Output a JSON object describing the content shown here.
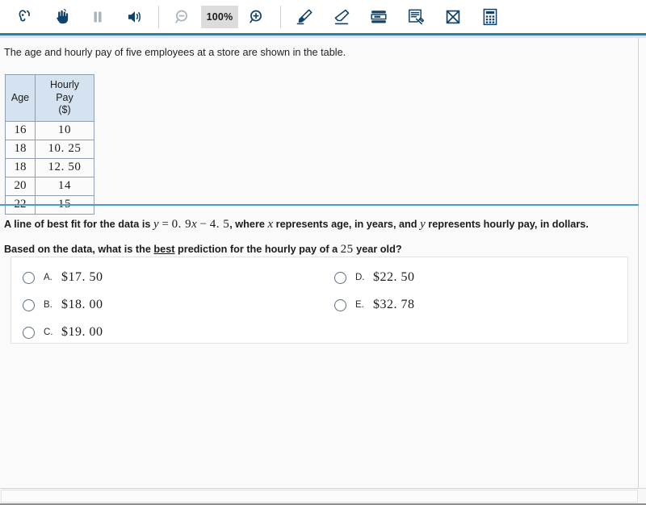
{
  "toolbar": {
    "tools": [
      {
        "name": "listen-icon",
        "label": "Listen",
        "state": "enabled"
      },
      {
        "name": "pointer-hand-icon",
        "label": "Pointer",
        "state": "enabled"
      },
      {
        "name": "pause-icon",
        "label": "Pause",
        "state": "disabled"
      },
      {
        "name": "volume-icon",
        "label": "Volume",
        "state": "enabled"
      },
      {
        "name": "zoom-out-icon",
        "label": "Zoom Out",
        "state": "enabled"
      },
      {
        "name": "zoom-level",
        "label": "100%",
        "state": "enabled"
      },
      {
        "name": "zoom-in-icon",
        "label": "Zoom In",
        "state": "enabled"
      },
      {
        "name": "highlighter-icon",
        "label": "Highlighter",
        "state": "enabled"
      },
      {
        "name": "eraser-icon",
        "label": "Eraser",
        "state": "enabled"
      },
      {
        "name": "line-reader-icon",
        "label": "Line Reader",
        "state": "enabled"
      },
      {
        "name": "notepad-icon",
        "label": "Notepad",
        "state": "enabled"
      },
      {
        "name": "cross-out-icon",
        "label": "Answer Eliminator",
        "state": "enabled"
      },
      {
        "name": "calculator-icon",
        "label": "Calculator",
        "state": "enabled"
      }
    ],
    "zoom_level": "100%",
    "accent_color": "#10436b",
    "disabled_color": "#a8b4bd",
    "rule_dark_color": "#2e7fa3",
    "rule_light_color": "#d7e6ee"
  },
  "question": {
    "intro": "The age and hourly pay of five employees at a store are shown in the table.",
    "best_fit_prefix": "A line of best fit for the data is ",
    "best_fit_eq_y": "y",
    "best_fit_eq_equals": " = ",
    "best_fit_eq_slope": "0. 9",
    "best_fit_eq_x": "x",
    "best_fit_eq_minus": " − ",
    "best_fit_eq_intercept": "4. 5",
    "best_fit_mid": ", where ",
    "best_fit_var_x": "x",
    "best_fit_x_desc": " represents age, in years, and ",
    "best_fit_var_y": "y",
    "best_fit_y_desc": " represents hourly pay, in dollars.",
    "prompt_prefix": "Based on the data, what is the ",
    "prompt_emph": "best",
    "prompt_mid": " prediction for the hourly pay of a ",
    "prompt_number": "25",
    "prompt_suffix": " year old?"
  },
  "table": {
    "headers": [
      "Age",
      "Hourly Pay\n($)"
    ],
    "header_age": "Age",
    "header_pay_line1": "Hourly Pay",
    "header_pay_line2": "($)",
    "rows": [
      {
        "age": "16",
        "pay": "10"
      },
      {
        "age": "18",
        "pay": "10. 25"
      },
      {
        "age": "18",
        "pay": "12. 50"
      },
      {
        "age": "20",
        "pay": "14"
      },
      {
        "age": "22",
        "pay": "15"
      }
    ],
    "header_bg": "#d5e3f0",
    "border_color": "#8f9fb0"
  },
  "choices": [
    {
      "letter": "A.",
      "value": "$17. 50",
      "selected": false
    },
    {
      "letter": "B.",
      "value": "$18. 00",
      "selected": false
    },
    {
      "letter": "C.",
      "value": "$19. 00",
      "selected": false
    },
    {
      "letter": "D.",
      "value": "$22. 50",
      "selected": false
    },
    {
      "letter": "E.",
      "value": "$32. 78",
      "selected": false
    }
  ],
  "divider_color": "#4b9dc4"
}
